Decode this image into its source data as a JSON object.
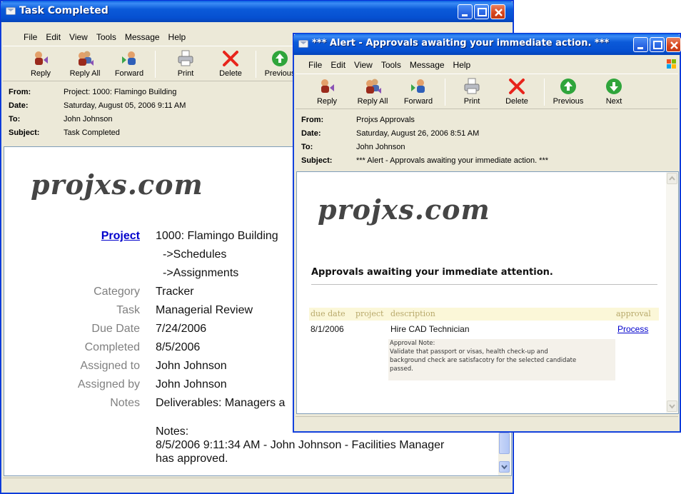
{
  "colors": {
    "title_blue": "#0b5ad9",
    "link": "#0000cc",
    "label_gray": "#808080"
  },
  "toolbar_icons": [
    "reply-icon",
    "reply-all-icon",
    "forward-icon",
    "print-icon",
    "delete-icon",
    "previous-icon",
    "next-icon"
  ],
  "window1": {
    "title": "Task Completed",
    "menu": [
      "File",
      "Edit",
      "View",
      "Tools",
      "Message",
      "Help"
    ],
    "toolbar": {
      "reply": "Reply",
      "reply_all": "Reply All",
      "forward": "Forward",
      "print": "Print",
      "delete": "Delete",
      "previous": "Previous"
    },
    "header": {
      "from_label": "From:",
      "from": "Project:  1000: Flamingo Building",
      "date_label": "Date:",
      "date": "Saturday, August 05, 2006 9:11 AM",
      "to_label": "To:",
      "to": "John Johnson",
      "subject_label": "Subject:",
      "subject": "Task Completed"
    },
    "logo": "projxs.com",
    "details": {
      "project_label": "Project",
      "project": "1000: Flamingo Building",
      "schedules": "->Schedules",
      "assignments": "->Assignments",
      "category_label": "Category",
      "category": "Tracker",
      "task_label": "Task",
      "task": "Managerial Review",
      "due_label": "Due Date",
      "due": "7/24/2006",
      "completed_label": "Completed",
      "completed": "8/5/2006",
      "assigned_to_label": "Assigned to",
      "assigned_to": "John Johnson",
      "assigned_by_label": "Assigned by",
      "assigned_by": "John Johnson",
      "notes_label": "Notes",
      "notes": "Deliverables: Managers a",
      "notes2_title": "Notes:",
      "notes2_line1": "8/5/2006 9:11:34 AM - John Johnson - Facilities Manager",
      "notes2_line2": "has approved."
    }
  },
  "window2": {
    "title": "*** Alert - Approvals awaiting your immediate action. ***",
    "menu": [
      "File",
      "Edit",
      "View",
      "Tools",
      "Message",
      "Help"
    ],
    "toolbar": {
      "reply": "Reply",
      "reply_all": "Reply All",
      "forward": "Forward",
      "print": "Print",
      "delete": "Delete",
      "previous": "Previous",
      "next": "Next"
    },
    "header": {
      "from_label": "From:",
      "from": "Projxs Approvals",
      "date_label": "Date:",
      "date": "Saturday, August 26, 2006 8:51 AM",
      "to_label": "To:",
      "to": "John Johnson",
      "subject_label": "Subject:",
      "subject": "*** Alert - Approvals awaiting your immediate action. ***"
    },
    "logo": "projxs.com",
    "heading": "Approvals awaiting your immediate attention.",
    "table": {
      "columns": [
        "due date",
        "project",
        "description",
        "approval"
      ],
      "row": {
        "due_date": "8/1/2006",
        "description": "Hire CAD Technician",
        "approval": "Process"
      },
      "note_title": "Approval Note:",
      "note_line1": "Validate that passport or visas, health check-up and",
      "note_line2": "background check are satisfacotry for the selected candidate",
      "note_line3": "passed."
    }
  }
}
